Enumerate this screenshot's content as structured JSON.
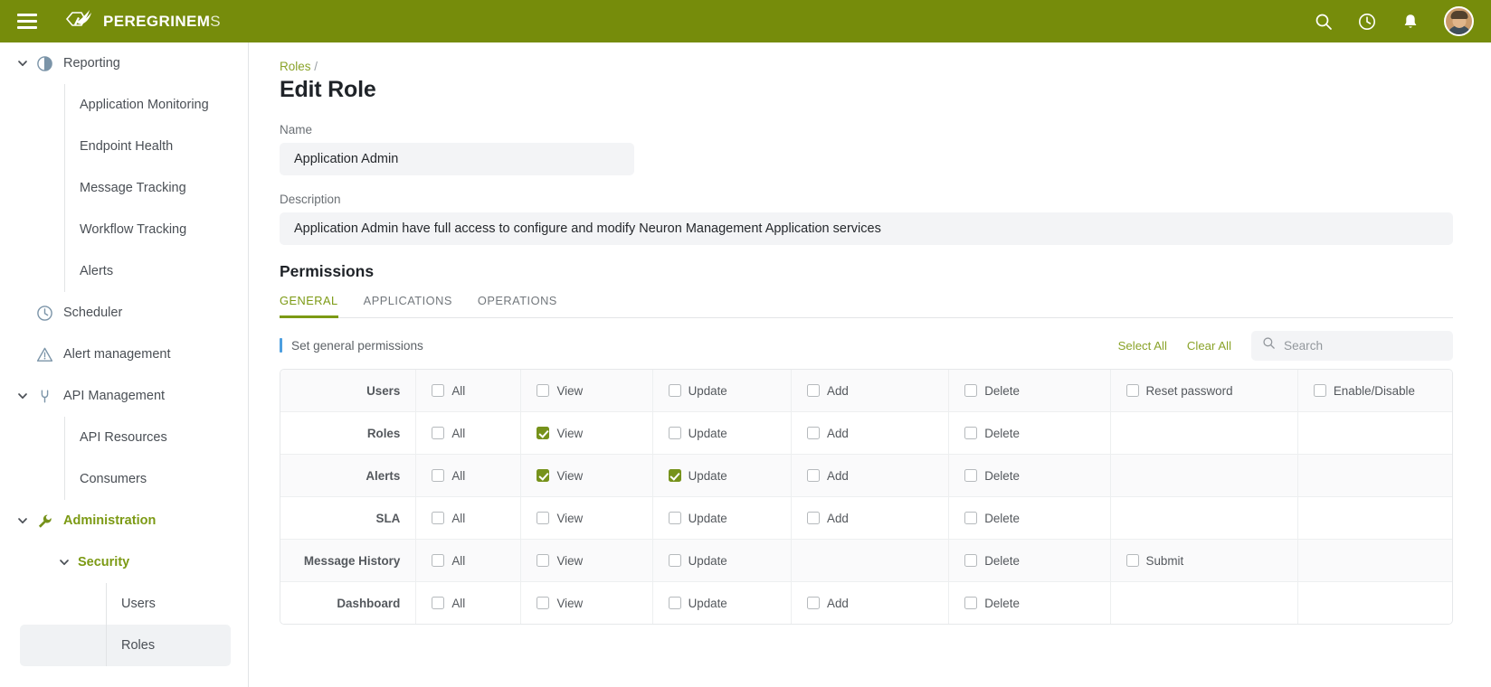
{
  "topbar": {
    "menu_icon": "hamburger-icon",
    "brand_bold": "PEREGRINEM",
    "brand_light": "S",
    "brand_color": "#768c0b",
    "actions": [
      {
        "icon": "search-icon"
      },
      {
        "icon": "clock-icon"
      },
      {
        "icon": "bell-icon"
      }
    ],
    "avatar": "user-avatar"
  },
  "sidebar": {
    "groups": [
      {
        "label": "Reporting",
        "icon": "chart-pie-icon",
        "expanded": true,
        "children": [
          {
            "label": "Application Monitoring",
            "selected": false
          },
          {
            "label": "Endpoint Health",
            "selected": false
          },
          {
            "label": "Message Tracking",
            "selected": false
          },
          {
            "label": "Workflow Tracking",
            "selected": false
          },
          {
            "label": "Alerts",
            "selected": false
          }
        ]
      },
      {
        "label": "Scheduler",
        "icon": "clock-icon",
        "expanded": false,
        "children": []
      },
      {
        "label": "Alert management",
        "icon": "warning-triangle-icon",
        "expanded": false,
        "children": []
      },
      {
        "label": "API Management",
        "icon": "plug-icon",
        "expanded": true,
        "children": [
          {
            "label": "API Resources",
            "selected": false
          },
          {
            "label": "Consumers",
            "selected": false
          }
        ]
      },
      {
        "label": "Administration",
        "icon": "wrench-icon",
        "expanded": true,
        "active": true,
        "subgroup": {
          "label": "Security",
          "expanded": true,
          "active": true,
          "children": [
            {
              "label": "Users",
              "selected": false
            },
            {
              "label": "Roles",
              "selected": true
            }
          ]
        }
      }
    ]
  },
  "main": {
    "breadcrumb": {
      "link": "Roles",
      "separator": "/"
    },
    "page_title": "Edit Role",
    "name": {
      "label": "Name",
      "value": "Application Admin"
    },
    "description": {
      "label": "Description",
      "value": "Application Admin have full access to configure and modify Neuron Management Application services"
    },
    "permissions": {
      "title": "Permissions",
      "tabs": [
        {
          "label": "GENERAL",
          "active": true
        },
        {
          "label": "APPLICATIONS",
          "active": false
        },
        {
          "label": "OPERATIONS",
          "active": false
        }
      ],
      "toolbar": {
        "hint": "Set general permissions",
        "select_all": "Select All",
        "clear_all": "Clear All",
        "search_placeholder": "Search",
        "search_value": "",
        "search_icon": "search-icon",
        "accent_bar_color": "#4d9fe0"
      },
      "accent_color": "#7c9a14",
      "checked_color": "#76921b",
      "rows": [
        {
          "name": "Users",
          "cells": [
            {
              "label": "All",
              "checked": false
            },
            {
              "label": "View",
              "checked": false
            },
            {
              "label": "Update",
              "checked": false
            },
            {
              "label": "Add",
              "checked": false
            },
            {
              "label": "Delete",
              "checked": false
            },
            {
              "label": "Reset password",
              "checked": false
            },
            {
              "label": "Enable/Disable",
              "checked": false
            }
          ]
        },
        {
          "name": "Roles",
          "cells": [
            {
              "label": "All",
              "checked": false
            },
            {
              "label": "View",
              "checked": true
            },
            {
              "label": "Update",
              "checked": false
            },
            {
              "label": "Add",
              "checked": false
            },
            {
              "label": "Delete",
              "checked": false
            },
            {
              "label": "",
              "checked": false
            },
            {
              "label": "",
              "checked": false
            }
          ]
        },
        {
          "name": "Alerts",
          "cells": [
            {
              "label": "All",
              "checked": false
            },
            {
              "label": "View",
              "checked": true
            },
            {
              "label": "Update",
              "checked": true
            },
            {
              "label": "Add",
              "checked": false
            },
            {
              "label": "Delete",
              "checked": false
            },
            {
              "label": "",
              "checked": false
            },
            {
              "label": "",
              "checked": false
            }
          ]
        },
        {
          "name": "SLA",
          "cells": [
            {
              "label": "All",
              "checked": false
            },
            {
              "label": "View",
              "checked": false
            },
            {
              "label": "Update",
              "checked": false
            },
            {
              "label": "Add",
              "checked": false
            },
            {
              "label": "Delete",
              "checked": false
            },
            {
              "label": "",
              "checked": false
            },
            {
              "label": "",
              "checked": false
            }
          ]
        },
        {
          "name": "Message History",
          "cells": [
            {
              "label": "All",
              "checked": false
            },
            {
              "label": "View",
              "checked": false
            },
            {
              "label": "Update",
              "checked": false
            },
            {
              "label": "",
              "checked": false
            },
            {
              "label": "Delete",
              "checked": false
            },
            {
              "label": "Submit",
              "checked": false
            },
            {
              "label": "",
              "checked": false
            }
          ]
        },
        {
          "name": "Dashboard",
          "cells": [
            {
              "label": "All",
              "checked": false
            },
            {
              "label": "View",
              "checked": false
            },
            {
              "label": "Update",
              "checked": false
            },
            {
              "label": "Add",
              "checked": false
            },
            {
              "label": "Delete",
              "checked": false
            },
            {
              "label": "",
              "checked": false
            },
            {
              "label": "",
              "checked": false
            }
          ]
        }
      ]
    }
  }
}
